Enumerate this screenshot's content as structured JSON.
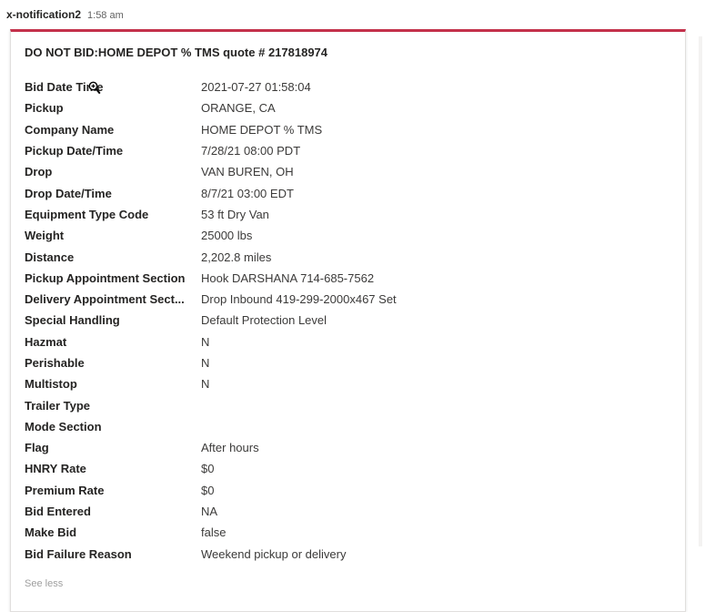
{
  "header": {
    "sender": "x-notification2",
    "time": "1:58 am"
  },
  "card": {
    "title": "DO NOT BID:HOME DEPOT % TMS quote # 217818974",
    "rows": [
      {
        "label": "Bid Date Time",
        "value": "2021-07-27 01:58:04"
      },
      {
        "label": "Pickup",
        "value": "ORANGE, CA"
      },
      {
        "label": "Company Name",
        "value": "HOME DEPOT % TMS"
      },
      {
        "label": "Pickup Date/Time",
        "value": "7/28/21 08:00 PDT"
      },
      {
        "label": "Drop",
        "value": "VAN BUREN, OH"
      },
      {
        "label": "Drop Date/Time",
        "value": "8/7/21 03:00 EDT"
      },
      {
        "label": "Equipment Type Code",
        "value": "53 ft Dry Van"
      },
      {
        "label": "Weight",
        "value": "25000 lbs"
      },
      {
        "label": "Distance",
        "value": "2,202.8 miles"
      },
      {
        "label": "Pickup Appointment Section",
        "value": "Hook DARSHANA 714-685-7562"
      },
      {
        "label": "Delivery Appointment Sect...",
        "value": "Drop Inbound 419-299-2000x467 Set"
      },
      {
        "label": "Special Handling",
        "value": "Default Protection Level"
      },
      {
        "label": "Hazmat",
        "value": "N"
      },
      {
        "label": "Perishable",
        "value": "N"
      },
      {
        "label": "Multistop",
        "value": "N"
      },
      {
        "label": "Trailer Type",
        "value": ""
      },
      {
        "label": "Mode Section",
        "value": ""
      },
      {
        "label": "Flag",
        "value": "After hours"
      },
      {
        "label": "HNRY Rate",
        "value": "$0"
      },
      {
        "label": "Premium Rate",
        "value": "$0"
      },
      {
        "label": "Bid Entered",
        "value": "NA"
      },
      {
        "label": "Make Bid",
        "value": "false"
      },
      {
        "label": "Bid Failure Reason",
        "value": "Weekend pickup or delivery"
      }
    ],
    "see_less": "See less"
  },
  "colors": {
    "accent": "#c4314b"
  },
  "icons": {
    "cursor": "zoom-cursor-icon"
  }
}
